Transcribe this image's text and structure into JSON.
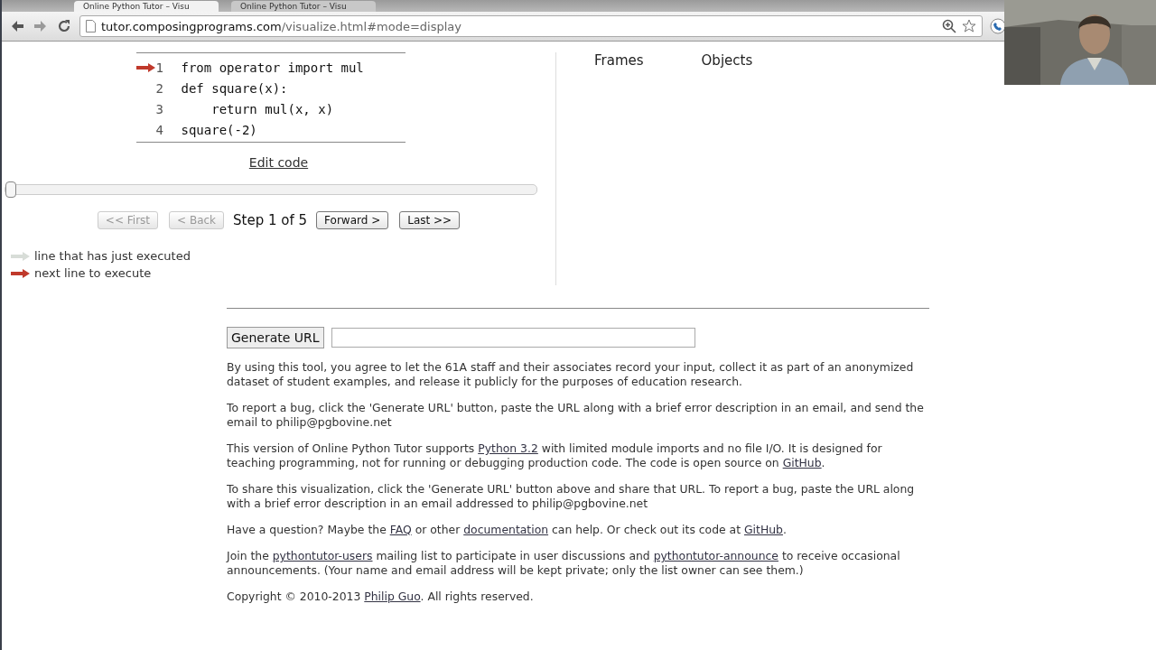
{
  "browser": {
    "tabs": [
      {
        "title": "Online Python Tutor – Visu",
        "selected": true
      },
      {
        "title": "Online Python Tutor – Visu",
        "selected": false
      }
    ],
    "url_host": "tutor.composingprograms.com",
    "url_path": "/visualize.html#mode=display"
  },
  "webcam": {
    "kind": "picture"
  },
  "code": {
    "lines": [
      {
        "number": "1",
        "text": "from operator import mul",
        "current": true
      },
      {
        "number": "2",
        "text": "def square(x):",
        "current": false
      },
      {
        "number": "3",
        "text": "    return mul(x, x)",
        "current": false
      },
      {
        "number": "4",
        "text": "square(-2)",
        "current": false
      }
    ]
  },
  "edit_link": "Edit code",
  "slider": {
    "level": 0
  },
  "nav": {
    "buttons": [
      {
        "label": "<< First",
        "disabled": true
      },
      {
        "label": "< Back",
        "disabled": true
      },
      {
        "label": "Forward >",
        "disabled": false
      },
      {
        "label": "Last >>",
        "disabled": false
      }
    ],
    "step": "Step 1 of 5"
  },
  "legend": [
    {
      "kind": "executed",
      "text": "line that has just executed"
    },
    {
      "kind": "next",
      "text": "next line to execute"
    }
  ],
  "headers": [
    "Frames",
    "Objects"
  ],
  "generate_button": "Generate URL",
  "paragraphs": [
    [
      {
        "text": "By using this tool, you agree to let the 61A staff and their associates record your input, collect it as part of an anonymized dataset of student examples, and release it publicly for the purposes of education research."
      }
    ],
    [
      {
        "text": "To report a bug, click the 'Generate URL' button, paste the URL along with a brief error description in an email, and send the email to philip@pgbovine.net"
      }
    ],
    [
      {
        "text": "This version of Online Python Tutor supports "
      },
      {
        "text": "Python 3.2",
        "link": true
      },
      {
        "text": " with limited module imports and no file I/O. It is designed for teaching programming, not for running or debugging production code. The code is open source on "
      },
      {
        "text": "GitHub",
        "link": true
      },
      {
        "text": "."
      }
    ],
    [
      {
        "text": "To share this visualization, click the 'Generate URL' button above and share that URL. To report a bug, paste the URL along with a brief error description in an email addressed to philip@pgbovine.net"
      }
    ],
    [
      {
        "text": "Have a question? Maybe the "
      },
      {
        "text": "FAQ",
        "link": true
      },
      {
        "text": " or other "
      },
      {
        "text": "documentation",
        "link": true
      },
      {
        "text": " can help. Or check out its code at "
      },
      {
        "text": "GitHub",
        "link": true
      },
      {
        "text": "."
      }
    ],
    [
      {
        "text": "Join the "
      },
      {
        "text": "pythontutor-users",
        "link": true
      },
      {
        "text": " mailing list to participate in user discussions and "
      },
      {
        "text": "pythontutor-announce",
        "link": true
      },
      {
        "text": " to receive occasional announcements. (Your name and email address will be kept private; only the list owner can see them.)"
      }
    ],
    [
      {
        "text": "Copyright © 2010-2013 "
      },
      {
        "text": "Philip Guo",
        "link": true
      },
      {
        "text": ". All rights reserved."
      }
    ]
  ]
}
